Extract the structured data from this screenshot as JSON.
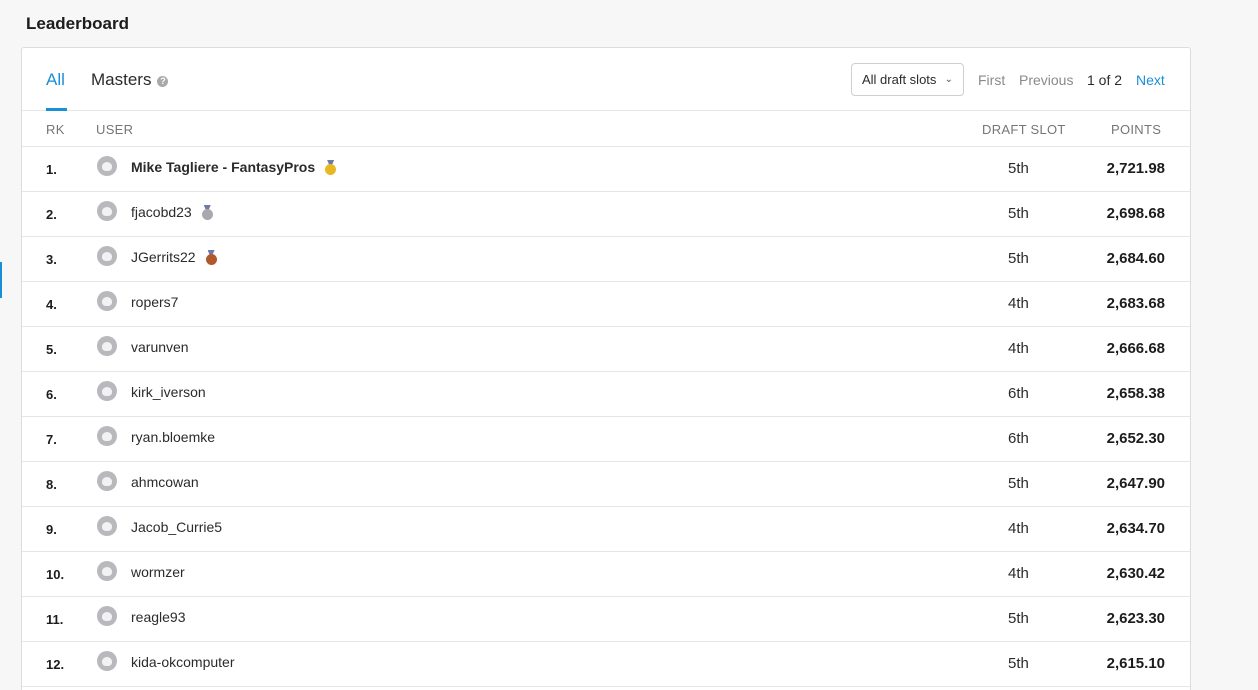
{
  "title": "Leaderboard",
  "tabs": {
    "all": "All",
    "masters": "Masters"
  },
  "filter": {
    "draft_slot": "All draft slots"
  },
  "pagination": {
    "first": "First",
    "previous": "Previous",
    "count": "1 of 2",
    "next": "Next"
  },
  "columns": {
    "rk": "RK",
    "user": "USER",
    "draft_slot": "DRAFT SLOT",
    "points": "POINTS"
  },
  "rows": [
    {
      "rank": "1.",
      "user": "Mike Tagliere - FantasyPros",
      "medal": "gold",
      "slot": "5th",
      "points": "2,721.98"
    },
    {
      "rank": "2.",
      "user": "fjacobd23",
      "medal": "silver",
      "slot": "5th",
      "points": "2,698.68"
    },
    {
      "rank": "3.",
      "user": "JGerrits22",
      "medal": "bronze",
      "slot": "5th",
      "points": "2,684.60"
    },
    {
      "rank": "4.",
      "user": "ropers7",
      "medal": "",
      "slot": "4th",
      "points": "2,683.68"
    },
    {
      "rank": "5.",
      "user": "varunven",
      "medal": "",
      "slot": "4th",
      "points": "2,666.68"
    },
    {
      "rank": "6.",
      "user": "kirk_iverson",
      "medal": "",
      "slot": "6th",
      "points": "2,658.38"
    },
    {
      "rank": "7.",
      "user": "ryan.bloemke",
      "medal": "",
      "slot": "6th",
      "points": "2,652.30"
    },
    {
      "rank": "8.",
      "user": "ahmcowan",
      "medal": "",
      "slot": "5th",
      "points": "2,647.90"
    },
    {
      "rank": "9.",
      "user": "Jacob_Currie5",
      "medal": "",
      "slot": "4th",
      "points": "2,634.70"
    },
    {
      "rank": "10.",
      "user": "wormzer",
      "medal": "",
      "slot": "4th",
      "points": "2,630.42"
    },
    {
      "rank": "11.",
      "user": "reagle93",
      "medal": "",
      "slot": "5th",
      "points": "2,623.30"
    },
    {
      "rank": "12.",
      "user": "kida-okcomputer",
      "medal": "",
      "slot": "5th",
      "points": "2,615.10"
    }
  ],
  "colors": {
    "accent": "#1a8fd6",
    "gold": "#e8b824",
    "silver": "#a8a8ad",
    "bronze": "#b0582a"
  }
}
